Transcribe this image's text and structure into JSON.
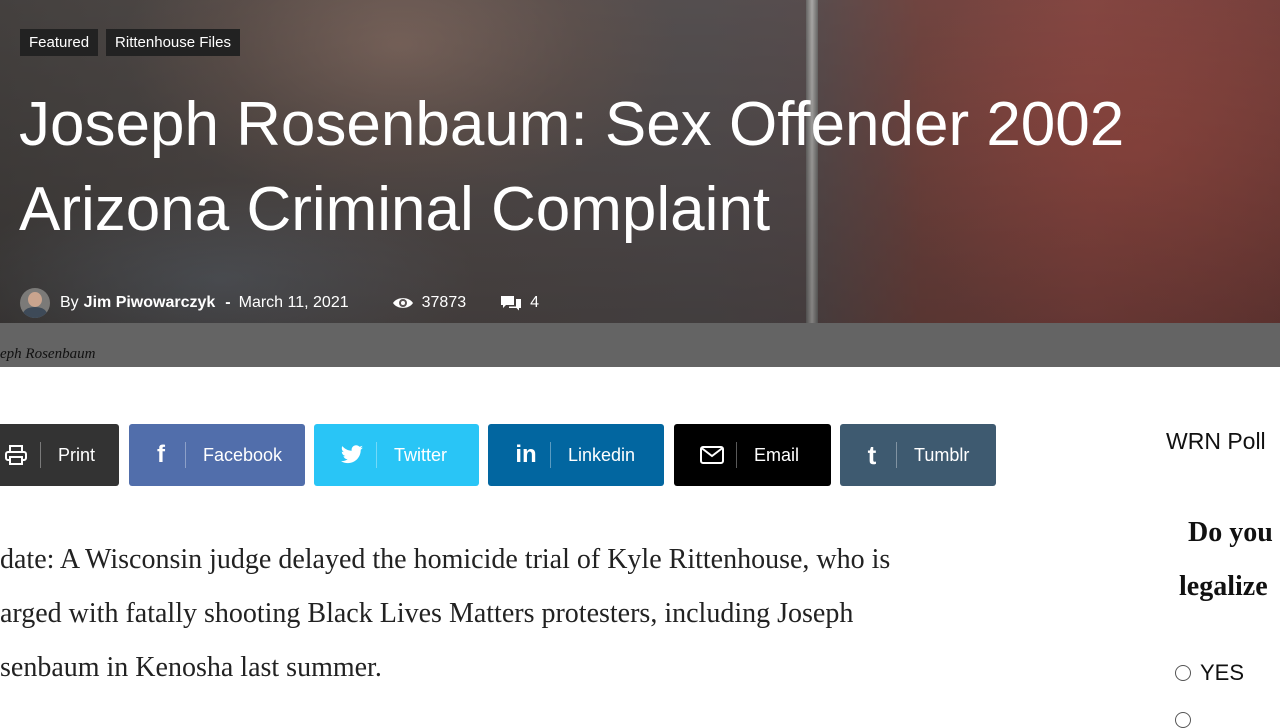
{
  "hero": {
    "categories": [
      "Featured",
      "Rittenhouse Files"
    ],
    "title": "Joseph Rosenbaum: Sex Offender 2002 Arizona Criminal Complaint",
    "by": "By",
    "author": "Jim Piwowarczyk",
    "dash": "-",
    "date": "March 11, 2021",
    "views": "37873",
    "comments": "4",
    "caption": "eph Rosenbaum"
  },
  "share": {
    "print": "Print",
    "facebook": "Facebook",
    "twitter": "Twitter",
    "linkedin": "Linkedin",
    "email": "Email",
    "tumblr": "Tumblr"
  },
  "article": {
    "paragraph": "pdate: A Wisconsin judge delayed the homicide trial of Kyle Rittenhouse, who is harged with fatally shooting Black Lives Matters protesters, including Joseph osenbaum in Kenosha last summer.",
    "lines": [
      "pdate: A Wisconsin judge delayed the homicide trial of Kyle Rittenhouse, who is",
      "harged with fatally shooting Black Lives Matters protesters, including Joseph",
      "osenbaum in Kenosha last summer."
    ]
  },
  "sidebar": {
    "poll_title": "WRN Poll",
    "question_line1": "Do you",
    "question_line2": "legalize",
    "options": [
      "YES",
      ""
    ]
  },
  "colors": {
    "print": "#333333",
    "facebook": "#516eab",
    "twitter": "#29c5f6",
    "linkedin": "#0266a0",
    "email": "#000000",
    "tumblr": "#3e5a70"
  }
}
